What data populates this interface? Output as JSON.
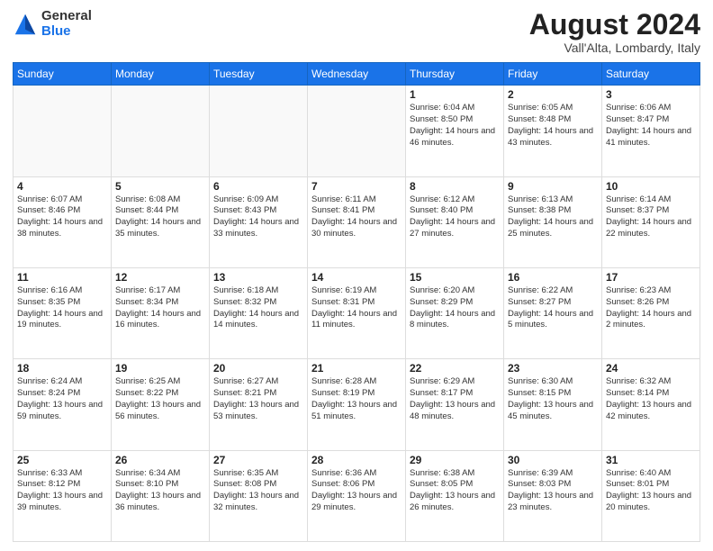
{
  "logo": {
    "general": "General",
    "blue": "Blue"
  },
  "title": "August 2024",
  "subtitle": "Vall'Alta, Lombardy, Italy",
  "days_header": [
    "Sunday",
    "Monday",
    "Tuesday",
    "Wednesday",
    "Thursday",
    "Friday",
    "Saturday"
  ],
  "weeks": [
    [
      {
        "num": "",
        "info": ""
      },
      {
        "num": "",
        "info": ""
      },
      {
        "num": "",
        "info": ""
      },
      {
        "num": "",
        "info": ""
      },
      {
        "num": "1",
        "info": "Sunrise: 6:04 AM\nSunset: 8:50 PM\nDaylight: 14 hours and 46 minutes."
      },
      {
        "num": "2",
        "info": "Sunrise: 6:05 AM\nSunset: 8:48 PM\nDaylight: 14 hours and 43 minutes."
      },
      {
        "num": "3",
        "info": "Sunrise: 6:06 AM\nSunset: 8:47 PM\nDaylight: 14 hours and 41 minutes."
      }
    ],
    [
      {
        "num": "4",
        "info": "Sunrise: 6:07 AM\nSunset: 8:46 PM\nDaylight: 14 hours and 38 minutes."
      },
      {
        "num": "5",
        "info": "Sunrise: 6:08 AM\nSunset: 8:44 PM\nDaylight: 14 hours and 35 minutes."
      },
      {
        "num": "6",
        "info": "Sunrise: 6:09 AM\nSunset: 8:43 PM\nDaylight: 14 hours and 33 minutes."
      },
      {
        "num": "7",
        "info": "Sunrise: 6:11 AM\nSunset: 8:41 PM\nDaylight: 14 hours and 30 minutes."
      },
      {
        "num": "8",
        "info": "Sunrise: 6:12 AM\nSunset: 8:40 PM\nDaylight: 14 hours and 27 minutes."
      },
      {
        "num": "9",
        "info": "Sunrise: 6:13 AM\nSunset: 8:38 PM\nDaylight: 14 hours and 25 minutes."
      },
      {
        "num": "10",
        "info": "Sunrise: 6:14 AM\nSunset: 8:37 PM\nDaylight: 14 hours and 22 minutes."
      }
    ],
    [
      {
        "num": "11",
        "info": "Sunrise: 6:16 AM\nSunset: 8:35 PM\nDaylight: 14 hours and 19 minutes."
      },
      {
        "num": "12",
        "info": "Sunrise: 6:17 AM\nSunset: 8:34 PM\nDaylight: 14 hours and 16 minutes."
      },
      {
        "num": "13",
        "info": "Sunrise: 6:18 AM\nSunset: 8:32 PM\nDaylight: 14 hours and 14 minutes."
      },
      {
        "num": "14",
        "info": "Sunrise: 6:19 AM\nSunset: 8:31 PM\nDaylight: 14 hours and 11 minutes."
      },
      {
        "num": "15",
        "info": "Sunrise: 6:20 AM\nSunset: 8:29 PM\nDaylight: 14 hours and 8 minutes."
      },
      {
        "num": "16",
        "info": "Sunrise: 6:22 AM\nSunset: 8:27 PM\nDaylight: 14 hours and 5 minutes."
      },
      {
        "num": "17",
        "info": "Sunrise: 6:23 AM\nSunset: 8:26 PM\nDaylight: 14 hours and 2 minutes."
      }
    ],
    [
      {
        "num": "18",
        "info": "Sunrise: 6:24 AM\nSunset: 8:24 PM\nDaylight: 13 hours and 59 minutes."
      },
      {
        "num": "19",
        "info": "Sunrise: 6:25 AM\nSunset: 8:22 PM\nDaylight: 13 hours and 56 minutes."
      },
      {
        "num": "20",
        "info": "Sunrise: 6:27 AM\nSunset: 8:21 PM\nDaylight: 13 hours and 53 minutes."
      },
      {
        "num": "21",
        "info": "Sunrise: 6:28 AM\nSunset: 8:19 PM\nDaylight: 13 hours and 51 minutes."
      },
      {
        "num": "22",
        "info": "Sunrise: 6:29 AM\nSunset: 8:17 PM\nDaylight: 13 hours and 48 minutes."
      },
      {
        "num": "23",
        "info": "Sunrise: 6:30 AM\nSunset: 8:15 PM\nDaylight: 13 hours and 45 minutes."
      },
      {
        "num": "24",
        "info": "Sunrise: 6:32 AM\nSunset: 8:14 PM\nDaylight: 13 hours and 42 minutes."
      }
    ],
    [
      {
        "num": "25",
        "info": "Sunrise: 6:33 AM\nSunset: 8:12 PM\nDaylight: 13 hours and 39 minutes."
      },
      {
        "num": "26",
        "info": "Sunrise: 6:34 AM\nSunset: 8:10 PM\nDaylight: 13 hours and 36 minutes."
      },
      {
        "num": "27",
        "info": "Sunrise: 6:35 AM\nSunset: 8:08 PM\nDaylight: 13 hours and 32 minutes."
      },
      {
        "num": "28",
        "info": "Sunrise: 6:36 AM\nSunset: 8:06 PM\nDaylight: 13 hours and 29 minutes."
      },
      {
        "num": "29",
        "info": "Sunrise: 6:38 AM\nSunset: 8:05 PM\nDaylight: 13 hours and 26 minutes."
      },
      {
        "num": "30",
        "info": "Sunrise: 6:39 AM\nSunset: 8:03 PM\nDaylight: 13 hours and 23 minutes."
      },
      {
        "num": "31",
        "info": "Sunrise: 6:40 AM\nSunset: 8:01 PM\nDaylight: 13 hours and 20 minutes."
      }
    ]
  ]
}
